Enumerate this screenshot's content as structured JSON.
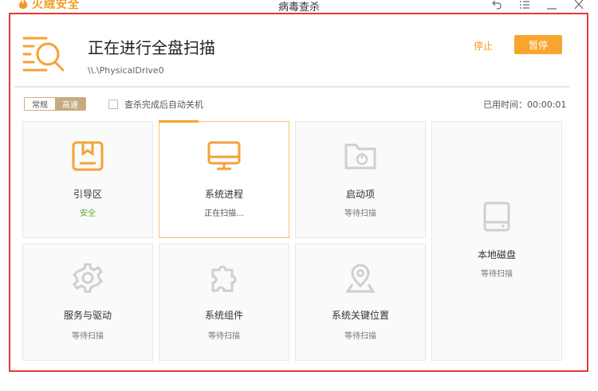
{
  "app": {
    "brand_name": "火绒安全",
    "window_title": "病毒查杀"
  },
  "header": {
    "title": "正在进行全盘扫描",
    "path": "\\\\.\\PhysicalDrive0",
    "stop_label": "停止",
    "pause_label": "暂停"
  },
  "options": {
    "mode_normal": "常规",
    "mode_fast": "高速",
    "auto_shutdown_label": "查杀完成后自动关机",
    "elapsed_label": "已用时间：00:00:01"
  },
  "tiles": [
    {
      "name": "引导区",
      "status": "安全",
      "icon": "boot-sector-icon"
    },
    {
      "name": "系统进程",
      "status": "正在扫描...",
      "icon": "monitor-icon"
    },
    {
      "name": "启动项",
      "status": "等待扫描",
      "icon": "startup-folder-icon"
    },
    {
      "name": "本地磁盘",
      "status": "等待扫描",
      "icon": "hard-disk-icon"
    },
    {
      "name": "服务与驱动",
      "status": "等待扫描",
      "icon": "gear-icon"
    },
    {
      "name": "系统组件",
      "status": "等待扫描",
      "icon": "puzzle-icon"
    },
    {
      "name": "系统关键位置",
      "status": "等待扫描",
      "icon": "location-pin-icon"
    }
  ],
  "colors": {
    "accent": "#f8a530",
    "safe": "#5aab2e",
    "annotation_frame": "#e53935"
  }
}
